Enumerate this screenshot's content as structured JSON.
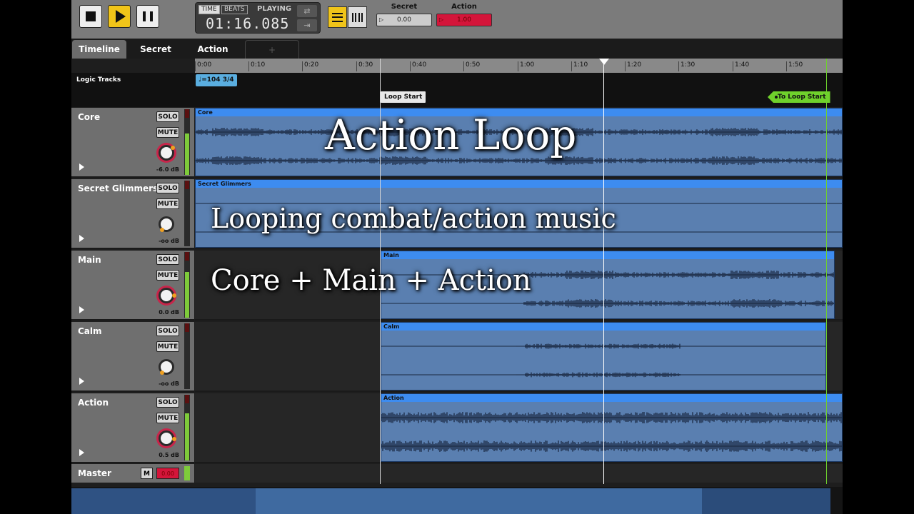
{
  "toolbar": {
    "time_mode": "TIME",
    "beats_mode": "BEATS",
    "status": "PLAYING",
    "time": "01:16.085",
    "params": [
      {
        "label": "Secret",
        "value": "0.00"
      },
      {
        "label": "Action",
        "value": "1.00"
      }
    ]
  },
  "tabs": [
    "Timeline",
    "Secret",
    "Action",
    "+"
  ],
  "ruler": [
    "0:00",
    "0:10",
    "0:20",
    "0:30",
    "0:40",
    "0:50",
    "1:00",
    "1:10",
    "1:20",
    "1:30",
    "1:40",
    "1:50"
  ],
  "logic": {
    "label": "Logic Tracks",
    "tempo": "♩=104 3/4",
    "loop_start": "Loop Start",
    "to_loop_start": "To Loop Start"
  },
  "tracks": [
    {
      "name": "Core",
      "solo": "SOLO",
      "mute": "MUTE",
      "db": "-6.0 dB",
      "clip": "Core",
      "level": 0.72
    },
    {
      "name": "Secret Glimmers",
      "solo": "SOLO",
      "mute": "MUTE",
      "db": "-oo dB",
      "clip": "Secret Glimmers",
      "level": 0.0
    },
    {
      "name": "Main",
      "solo": "SOLO",
      "mute": "MUTE",
      "db": "0.0 dB",
      "clip": "Main",
      "level": 0.8
    },
    {
      "name": "Calm",
      "solo": "SOLO",
      "mute": "MUTE",
      "db": "-oo dB",
      "clip": "Calm",
      "level": 0.0
    },
    {
      "name": "Action",
      "solo": "SOLO",
      "mute": "MUTE",
      "db": "0.5 dB",
      "clip": "Action",
      "level": 0.82
    }
  ],
  "master": {
    "name": "Master",
    "m": "M",
    "vol": "0.00"
  },
  "captions": {
    "title": "Action Loop",
    "line1": "Looping combat/action music",
    "line2": "Core + Main + Action"
  },
  "colors": {
    "accent": "#f0c419",
    "clip": "#5a7fb0",
    "clip_header": "#3d8cf0",
    "loop_marker": "#6fd12c",
    "param_active": "#d4153a"
  }
}
